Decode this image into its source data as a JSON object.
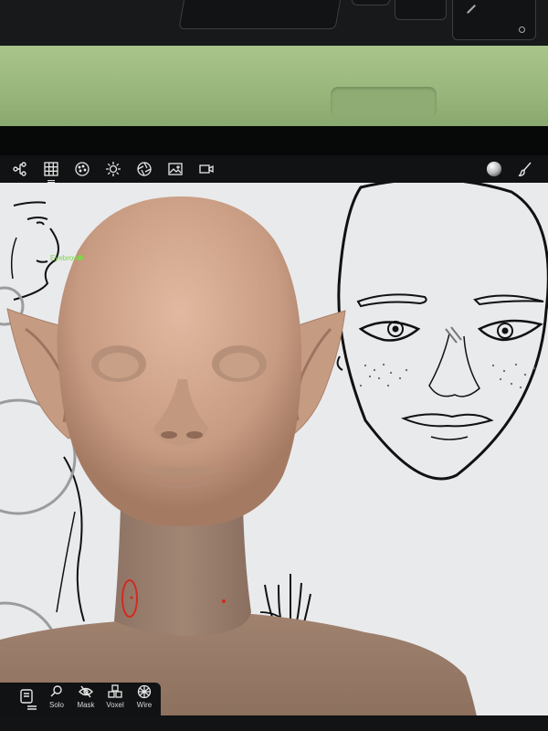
{
  "toolbar": {
    "left_icons": [
      "scene-tree-icon",
      "grid-icon",
      "material-sphere-icon",
      "light-icon",
      "camera-aperture-icon",
      "image-icon",
      "video-icon"
    ],
    "right_icons": [
      "matcap-preview-icon",
      "brush-icon"
    ],
    "overlay_label": "Eyebrow"
  },
  "bottom_bar": {
    "items": [
      {
        "label": "Solo",
        "icon": "search-icon"
      },
      {
        "label": "Mask",
        "icon": "eye-slash-icon"
      },
      {
        "label": "Voxel",
        "icon": "voxel-icon"
      },
      {
        "label": "Wire",
        "icon": "wireframe-icon"
      }
    ]
  },
  "colors": {
    "case": "#9ab87d",
    "toolbar": "#111213",
    "canvas": "#e9eaec",
    "skin": "#c49a82",
    "accent_marker": "#7cd64a",
    "annotation": "#d32a1f"
  }
}
